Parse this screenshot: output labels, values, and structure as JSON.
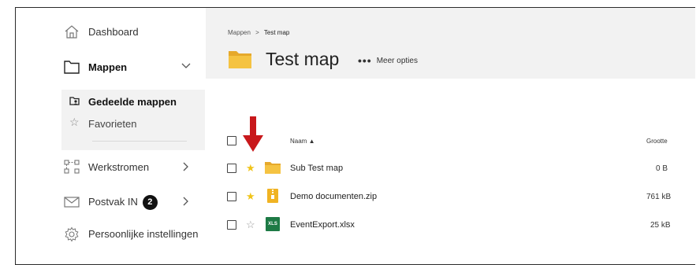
{
  "sidebar": {
    "dashboard": "Dashboard",
    "mappen": "Mappen",
    "gedeelde_mappen": "Gedeelde mappen",
    "favorieten": "Favorieten",
    "werkstromen": "Werkstromen",
    "postvak": "Postvak IN",
    "postvak_count": "2",
    "instellingen": "Persoonlijke instellingen"
  },
  "breadcrumb": {
    "root": "Mappen",
    "sep": ">",
    "current": "Test map"
  },
  "header": {
    "title": "Test map",
    "more_label": "Meer opties",
    "more_dots": "•••"
  },
  "table": {
    "col_name": "Naam ▲",
    "col_size": "Grootte",
    "rows": [
      {
        "name": "Sub Test map",
        "size": "0 B",
        "favorite": true,
        "type": "folder"
      },
      {
        "name": "Demo documenten.zip",
        "size": "761 kB",
        "favorite": true,
        "type": "zip"
      },
      {
        "name": "EventExport.xlsx",
        "size": "25 kB",
        "favorite": false,
        "type": "xlsx"
      }
    ]
  },
  "icons": {
    "xls_label": "XLS"
  },
  "colors": {
    "arrow": "#c8181b",
    "star": "#f0c419",
    "folder": "#f5c342",
    "xls": "#1d7a45",
    "header_bg": "#f2f2f2"
  }
}
